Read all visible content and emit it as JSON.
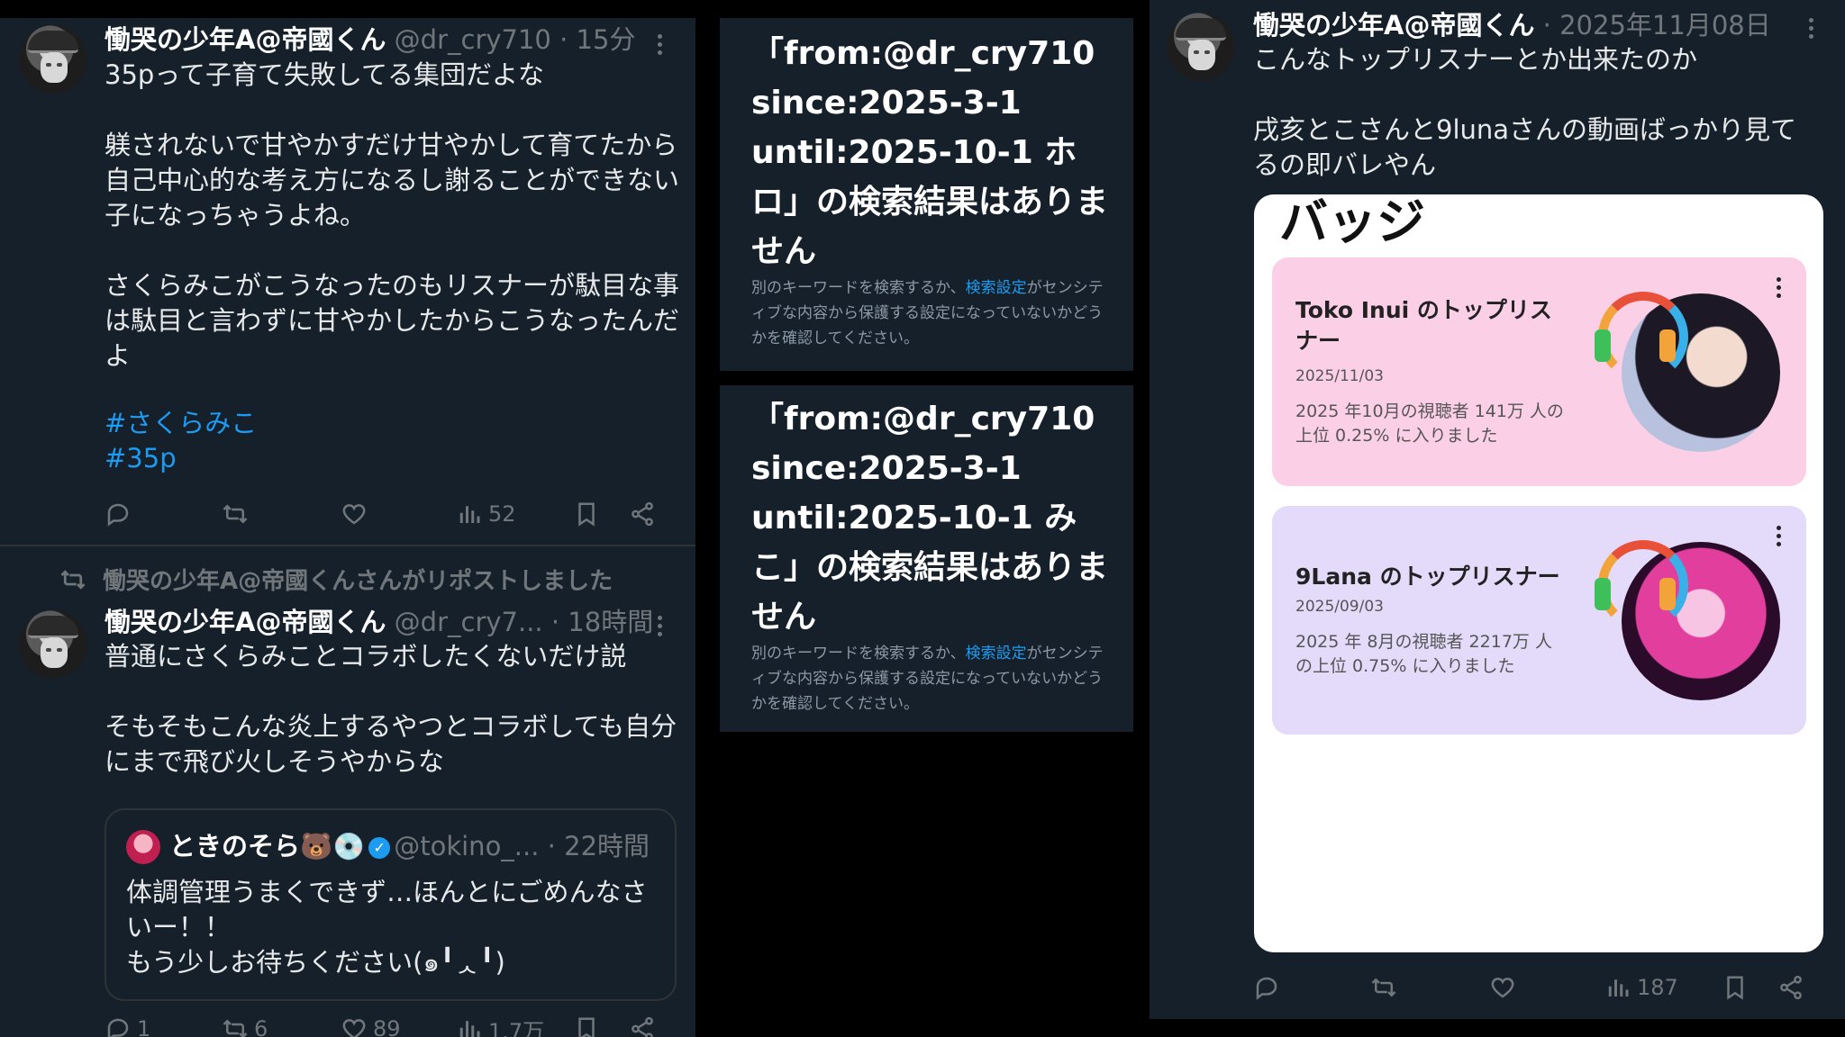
{
  "left_panel": {
    "tweet1": {
      "name": "慟哭の少年A@帝國くん",
      "meta": "@dr_cry710 · 15分",
      "body": "35pって子育て失敗してる集団だよな\n\n躾されないで甘やかすだけ甘やかして育てたから自己中心的な考え方になるし謝ることができない子になっちゃうよね。\n\nさくらみこがこうなったのもリスナーが駄目な事は駄目と言わずに甘やかしたからこうなったんだよ",
      "hashtags": [
        "#さくらみこ",
        "#35p"
      ],
      "actions": {
        "reply": "",
        "repost": "",
        "like": "",
        "views": "52"
      }
    },
    "repost_label": "慟哭の少年A@帝國くんさんがリポストしました",
    "tweet2": {
      "name": "慟哭の少年A@帝國くん",
      "meta": "@dr_cry7... · 18時間",
      "body": "普通にさくらみことコラボしたくないだけ説\n\nそもそもこんな炎上するやつとコラボしても自分にまで飛び火しそうやからな",
      "quote": {
        "name": "ときのそら🐻💿",
        "meta": "@tokino_... · 22時間",
        "text": "体調管理うまくできず…ほんとにごめんなさいー！！\nもう少しお待ちください(๑╹ᆺ╹)"
      },
      "actions": {
        "reply": "1",
        "repost": "6",
        "like": "89",
        "views": "1.7万"
      }
    }
  },
  "mid_panel": {
    "result1": {
      "heading": "「from:@dr_cry710 since:2025-3-1 until:2025-10-1 ホロ」の検索結果はありません",
      "sub_before": "別のキーワードを検索するか、",
      "sub_link": "検索設定",
      "sub_after": "がセンシティブな内容から保護する設定になっていないかどうかを確認してください。"
    },
    "result2": {
      "heading": "「from:@dr_cry710 since:2025-3-1 until:2025-10-1 みこ」の検索結果はありません",
      "sub_before": "別のキーワードを検索するか、",
      "sub_link": "検索設定",
      "sub_after": "がセンシティブな内容から保護する設定になっていないかどうかを確認してください。"
    }
  },
  "right_panel": {
    "tweet": {
      "name": "慟哭の少年A@帝國くん",
      "meta": "· 2025年11月08日",
      "body": "こんなトップリスナーとか出来たのか\n\n戌亥とこさんと9lunaさんの動画ばっかり見てるの即バレやん",
      "actions": {
        "reply": "",
        "repost": "",
        "like": "",
        "views": "187"
      }
    },
    "badge_page": {
      "title": "バッジ",
      "cards": [
        {
          "title": "Toko Inui のトップリスナー",
          "date": "2025/11/03",
          "desc": "2025 年10月の視聴者 141万 人の上位 0.25% に入りました",
          "bg": "#fbd0e6"
        },
        {
          "title": "9Lana のトップリスナー",
          "date": "2025/09/03",
          "desc": "2025 年 8月の視聴者 2217万 人の上位 0.75% に入りました",
          "bg": "#e4dafa"
        }
      ]
    }
  },
  "colors": {
    "panel_bg": "#15202b",
    "link": "#1d9bf0",
    "muted": "#71767b"
  }
}
